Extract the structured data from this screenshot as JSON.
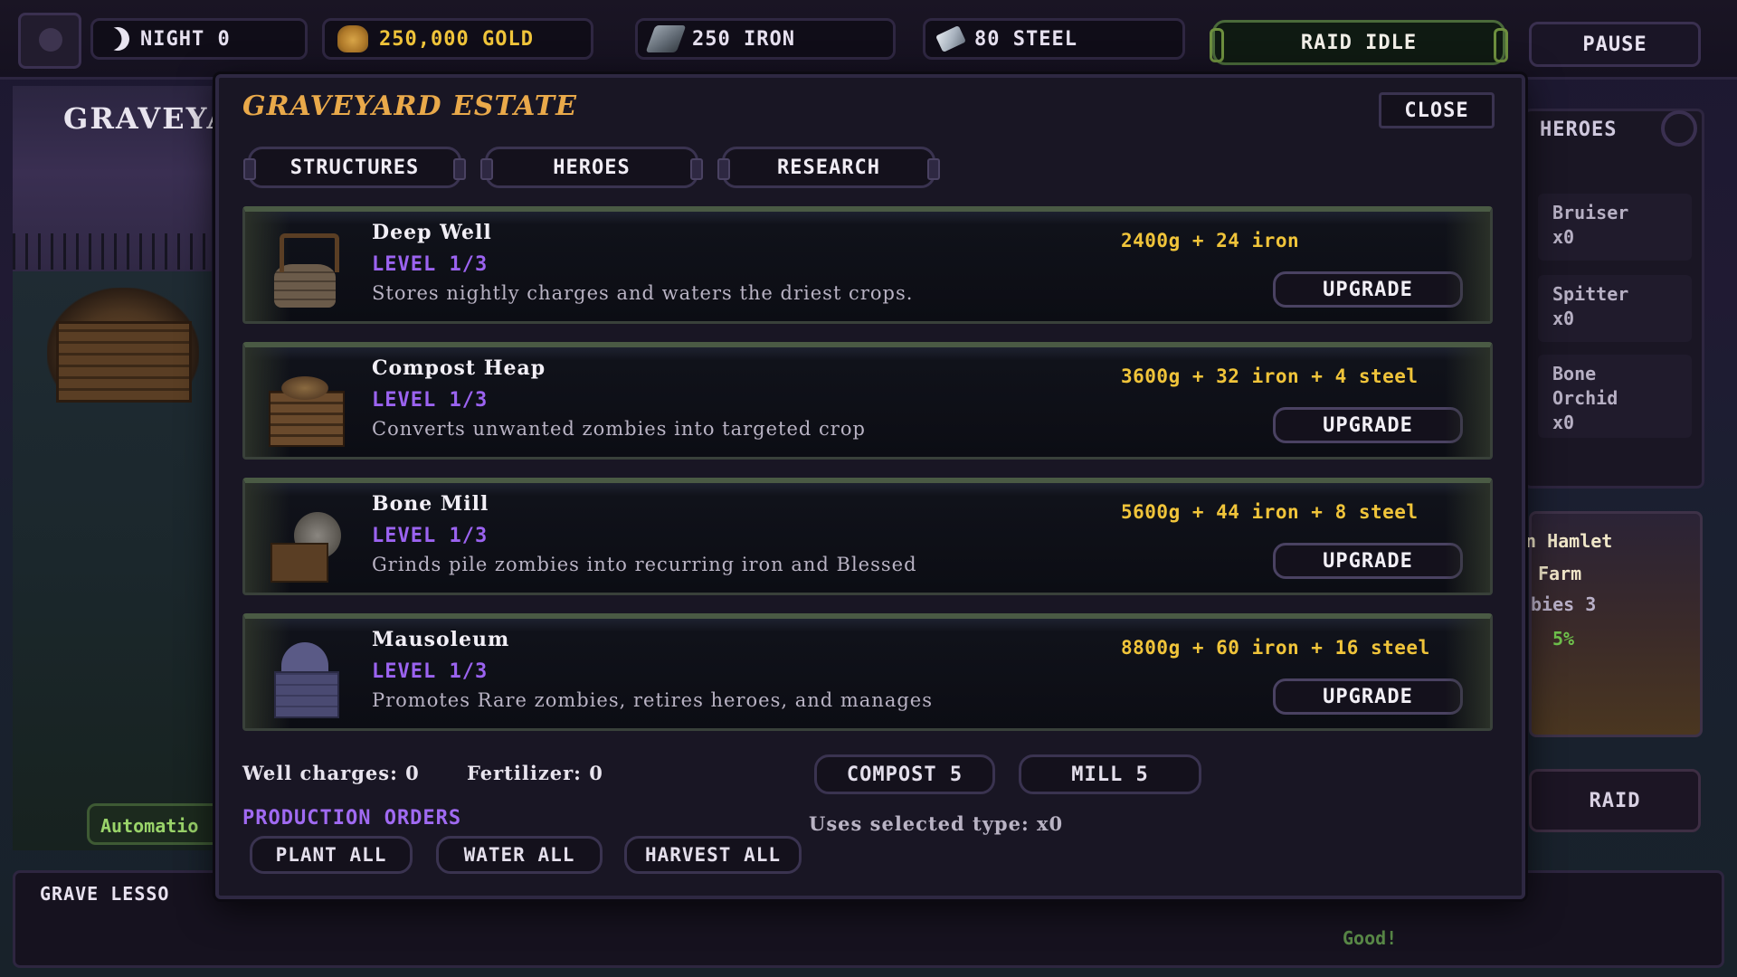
{
  "topbar": {
    "night": "NIGHT 0",
    "gold": "250,000 GOLD",
    "iron": "250 IRON",
    "steel": "80 STEEL",
    "raid": "RAID IDLE",
    "pause": "PAUSE"
  },
  "background": {
    "left_title": "GRAVEYAR",
    "automation": "Automatio",
    "right_tab": "HEROES",
    "heroes": [
      {
        "name": "Bruiser",
        "count": "x0"
      },
      {
        "name": "Spitter",
        "count": "x0"
      },
      {
        "name_line1": "Bone",
        "name_line2": "Orchid",
        "count": "x0"
      }
    ],
    "hamlet": {
      "line1": "n Hamlet",
      "line2": "Farm",
      "line3": "bies  3",
      "pct": "5%"
    },
    "raid_button": "RAID",
    "message_title": "GRAVE LESSO",
    "message_good": "Good!"
  },
  "modal": {
    "title": "GRAVEYARD ESTATE",
    "close": "CLOSE",
    "tabs": [
      "STRUCTURES",
      "HEROES",
      "RESEARCH"
    ],
    "structures": [
      {
        "name": "Deep Well",
        "level": "LEVEL 1/3",
        "description": "Stores nightly charges and waters the driest crops.",
        "cost": "2400g + 24 iron",
        "button": "UPGRADE",
        "icon": "well-icon"
      },
      {
        "name": "Compost Heap",
        "level": "LEVEL 1/3",
        "description": "Converts unwanted zombies into targeted crop",
        "cost": "3600g + 32 iron + 4 steel",
        "button": "UPGRADE",
        "icon": "compost-icon"
      },
      {
        "name": "Bone Mill",
        "level": "LEVEL 1/3",
        "description": "Grinds pile zombies into recurring iron and Blessed",
        "cost": "5600g + 44 iron + 8 steel",
        "button": "UPGRADE",
        "icon": "bone-mill-icon"
      },
      {
        "name": "Mausoleum",
        "level": "LEVEL 1/3",
        "description": "Promotes Rare zombies, retires heroes, and manages",
        "cost": "8800g + 60 iron + 16 steel",
        "button": "UPGRADE",
        "icon": "mausoleum-icon"
      }
    ],
    "well_charges": "Well charges: 0",
    "fertilizer": "Fertilizer: 0",
    "compost_button": "COMPOST 5",
    "mill_button": "MILL 5",
    "uses_selected": "Uses selected type:  x0",
    "production_orders": "PRODUCTION ORDERS",
    "orders": [
      "PLANT ALL",
      "WATER ALL",
      "HARVEST ALL"
    ]
  },
  "colors": {
    "accent_gold": "#e9a94a",
    "cost_yellow": "#f0c43a",
    "level_purple": "#9b63f0",
    "orders_purple": "#a06af2"
  }
}
